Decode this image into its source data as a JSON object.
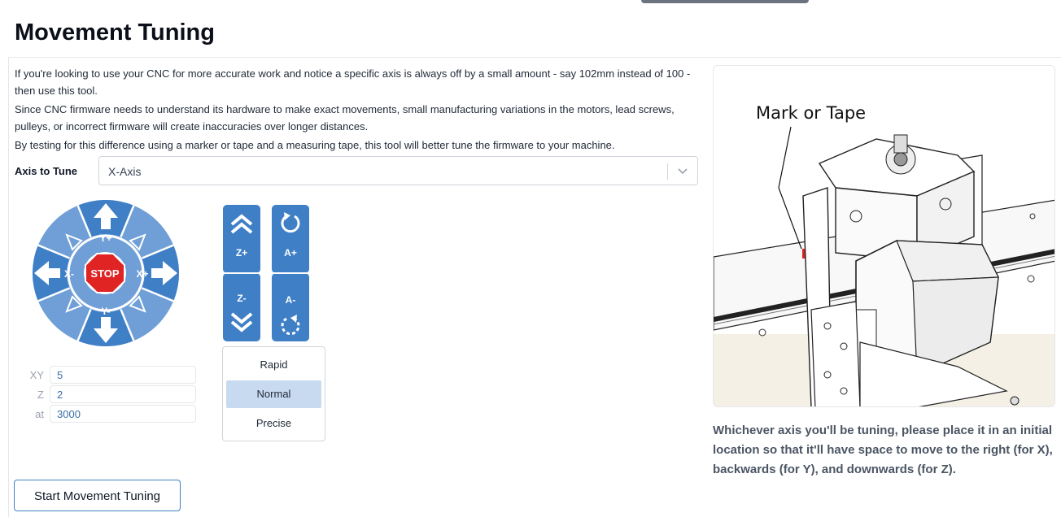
{
  "page": {
    "title": "Movement Tuning",
    "description": [
      "If you're looking to use your CNC for more accurate work and notice a specific axis is always off by a small amount - say 102mm instead of 100 - then use this tool.",
      "Since CNC firmware needs to understand its hardware to make exact movements, small manufacturing variations in the motors, lead screws, pulleys, or incorrect firmware will create inaccuracies over longer distances.",
      "By testing for this difference using a marker or tape and a measuring tape, this tool will better tune the firmware to your machine."
    ]
  },
  "axis_select": {
    "label": "Axis to Tune",
    "value": "X-Axis"
  },
  "jog": {
    "stop_label": "STOP",
    "y_plus": "Y+",
    "y_minus": "Y-",
    "x_plus": "X+",
    "x_minus": "X-",
    "z_plus": "Z+",
    "z_minus": "Z-",
    "a_plus": "A+",
    "a_minus": "A-"
  },
  "step": {
    "xy_label": "XY",
    "xy_value": "5",
    "z_label": "Z",
    "z_value": "2",
    "feed_label": "at",
    "feed_value": "3000"
  },
  "speed": {
    "options": [
      "Rapid",
      "Normal",
      "Precise"
    ],
    "selected": "Normal"
  },
  "illustration": {
    "label": "Mark or Tape"
  },
  "caption": "Whichever axis you'll be tuning, please place it in an initial location so that it'll have space to move to the right (for X), backwards (for Y), and downwards (for Z).",
  "start_button": "Start Movement Tuning",
  "colors": {
    "accent": "#3f7fc6",
    "accent_light": "#6f9fd6",
    "stop": "#e02424",
    "selected": "#c7daf0"
  }
}
